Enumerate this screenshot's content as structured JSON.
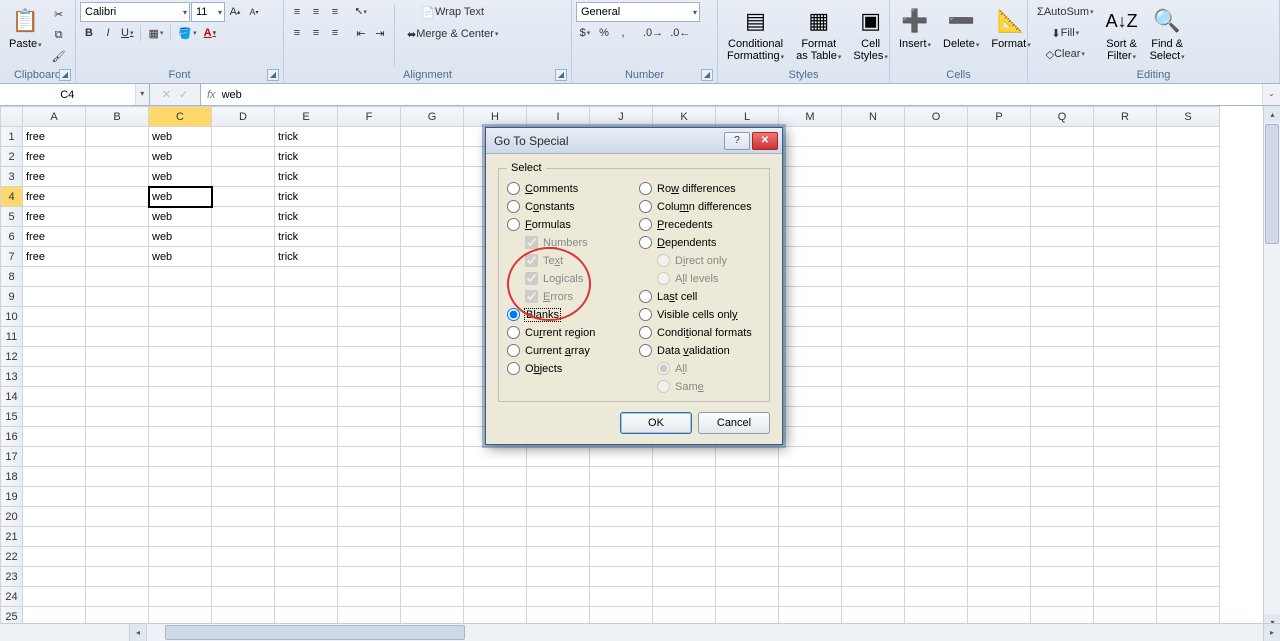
{
  "ribbon": {
    "clipboard": {
      "label": "Clipboard",
      "paste": "Paste"
    },
    "font": {
      "label": "Font",
      "name": "Calibri",
      "size": "11"
    },
    "alignment": {
      "label": "Alignment",
      "wrap": "Wrap Text",
      "merge": "Merge & Center"
    },
    "number": {
      "label": "Number",
      "format": "General"
    },
    "styles": {
      "label": "Styles",
      "cf": "Conditional\nFormatting",
      "fat": "Format\nas Table",
      "cs": "Cell\nStyles"
    },
    "cells": {
      "label": "Cells",
      "ins": "Insert",
      "del": "Delete",
      "fmt": "Format"
    },
    "editing": {
      "label": "Editing",
      "autosum": "AutoSum",
      "fill": "Fill",
      "clear": "Clear",
      "sort": "Sort &\nFilter",
      "find": "Find &\nSelect"
    }
  },
  "namebox": "C4",
  "formula": "web",
  "columns": [
    "A",
    "B",
    "C",
    "D",
    "E",
    "F",
    "G",
    "H",
    "I",
    "J",
    "K",
    "L",
    "M",
    "N",
    "O",
    "P",
    "Q",
    "R",
    "S"
  ],
  "active_col": "C",
  "active_row": 4,
  "rows": [
    {
      "n": 1,
      "A": "free",
      "C": "web",
      "E": "trick"
    },
    {
      "n": 2,
      "A": "free",
      "C": "web",
      "E": "trick"
    },
    {
      "n": 3,
      "A": "free",
      "C": "web",
      "E": "trick"
    },
    {
      "n": 4,
      "A": "free",
      "C": "web",
      "E": "trick"
    },
    {
      "n": 5,
      "A": "free",
      "C": "web",
      "E": "trick"
    },
    {
      "n": 6,
      "A": "free",
      "C": "web",
      "E": "trick"
    },
    {
      "n": 7,
      "A": "free",
      "C": "web",
      "E": "trick"
    }
  ],
  "dialog": {
    "title": "Go To Special",
    "legend": "Select",
    "left": [
      {
        "k": "comments",
        "label": "Comments",
        "type": "radio",
        "checked": false,
        "u": "C"
      },
      {
        "k": "constants",
        "label": "Constants",
        "type": "radio",
        "checked": false,
        "u": "o"
      },
      {
        "k": "formulas",
        "label": "Formulas",
        "type": "radio",
        "checked": false,
        "u": "F"
      },
      {
        "k": "numbers",
        "label": "Numbers",
        "type": "check",
        "checked": true,
        "disabled": true,
        "indent": true,
        "u": "u"
      },
      {
        "k": "text",
        "label": "Text",
        "type": "check",
        "checked": true,
        "disabled": true,
        "indent": true,
        "u": "x"
      },
      {
        "k": "logicals",
        "label": "Logicals",
        "type": "check",
        "checked": true,
        "disabled": true,
        "indent": true,
        "u": "g"
      },
      {
        "k": "errors",
        "label": "Errors",
        "type": "check",
        "checked": true,
        "disabled": true,
        "indent": true,
        "u": "E"
      },
      {
        "k": "blanks",
        "label": "Blanks",
        "type": "radio",
        "checked": true,
        "focus": true,
        "u": "k"
      },
      {
        "k": "curregion",
        "label": "Current region",
        "type": "radio",
        "checked": false,
        "u": "r"
      },
      {
        "k": "curarray",
        "label": "Current array",
        "type": "radio",
        "checked": false,
        "u": "a"
      },
      {
        "k": "objects",
        "label": "Objects",
        "type": "radio",
        "checked": false,
        "u": "b"
      }
    ],
    "right": [
      {
        "k": "rowdiff",
        "label": "Row differences",
        "type": "radio",
        "checked": false,
        "u": "w"
      },
      {
        "k": "coldiff",
        "label": "Column differences",
        "type": "radio",
        "checked": false,
        "u": "m"
      },
      {
        "k": "precedents",
        "label": "Precedents",
        "type": "radio",
        "checked": false,
        "u": "P"
      },
      {
        "k": "dependents",
        "label": "Dependents",
        "type": "radio",
        "checked": false,
        "u": "D"
      },
      {
        "k": "direct",
        "label": "Direct only",
        "type": "radio",
        "checked": true,
        "disabled": true,
        "indent": true,
        "u": "i"
      },
      {
        "k": "alllevels",
        "label": "All levels",
        "type": "radio",
        "checked": false,
        "disabled": true,
        "indent": true,
        "u": "l"
      },
      {
        "k": "lastcell",
        "label": "Last cell",
        "type": "radio",
        "checked": false,
        "u": "s"
      },
      {
        "k": "visible",
        "label": "Visible cells only",
        "type": "radio",
        "checked": false,
        "u": "y"
      },
      {
        "k": "condfmt",
        "label": "Conditional formats",
        "type": "radio",
        "checked": false,
        "u": "t"
      },
      {
        "k": "dataval",
        "label": "Data validation",
        "type": "radio",
        "checked": false,
        "u": "v"
      },
      {
        "k": "all",
        "label": "All",
        "type": "radio",
        "checked": true,
        "disabled": true,
        "indent": true,
        "u": "l"
      },
      {
        "k": "same",
        "label": "Same",
        "type": "radio",
        "checked": false,
        "disabled": true,
        "indent": true,
        "u": "e"
      }
    ],
    "ok": "OK",
    "cancel": "Cancel"
  }
}
